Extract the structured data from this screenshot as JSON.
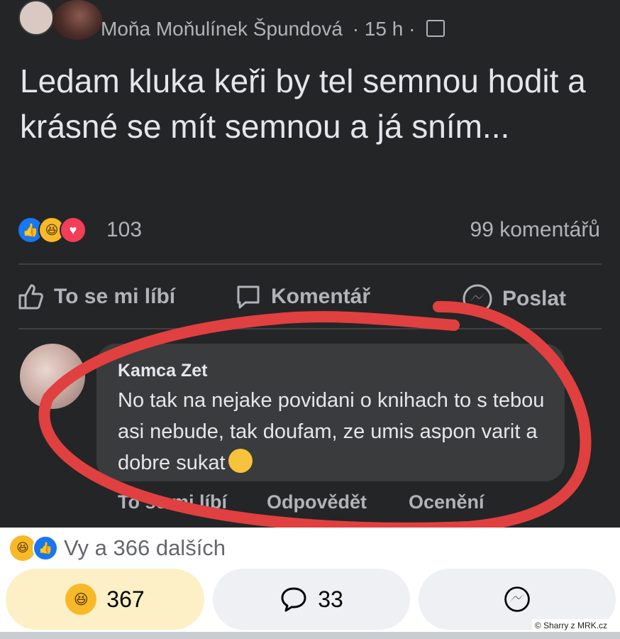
{
  "post": {
    "author": "Moňa Moňulínek Špundová",
    "meta": "· 15 h ·",
    "text": "Ledam kluka keři by tel semnou hodit a krásné se mít semnou a já sním...",
    "reaction_count": "103",
    "comment_count": "99 komentářů",
    "reaction_icons": [
      "like-icon",
      "haha-icon",
      "love-icon"
    ]
  },
  "actions": {
    "like": "To se mi líbí",
    "comment": "Komentář",
    "share": "Poslat"
  },
  "comment": {
    "author": "Kamca Zet",
    "text": "No tak na nejake povidani o knihach to s tebou asi nebude, tak doufam, ze umis aspon varit a dobre sukat",
    "emoji": "thinking-face-icon",
    "actions": {
      "like": "To se mi líbí",
      "reply": "Odpovědět",
      "award": "Ocenění"
    }
  },
  "footer": {
    "summary": "Vy a 366 dalších",
    "reactions_count": "367",
    "comments_count": "33",
    "credit": "© Sharry z MRK.cz"
  },
  "colors": {
    "dark_bg": "#242526",
    "bubble": "#3a3b3c",
    "text_light": "#e4e6eb",
    "text_muted": "#b0b3b8",
    "annotation": "#e0403f",
    "reaction_pill": "#fdf0c6",
    "neutral_pill": "#eef0f3"
  }
}
